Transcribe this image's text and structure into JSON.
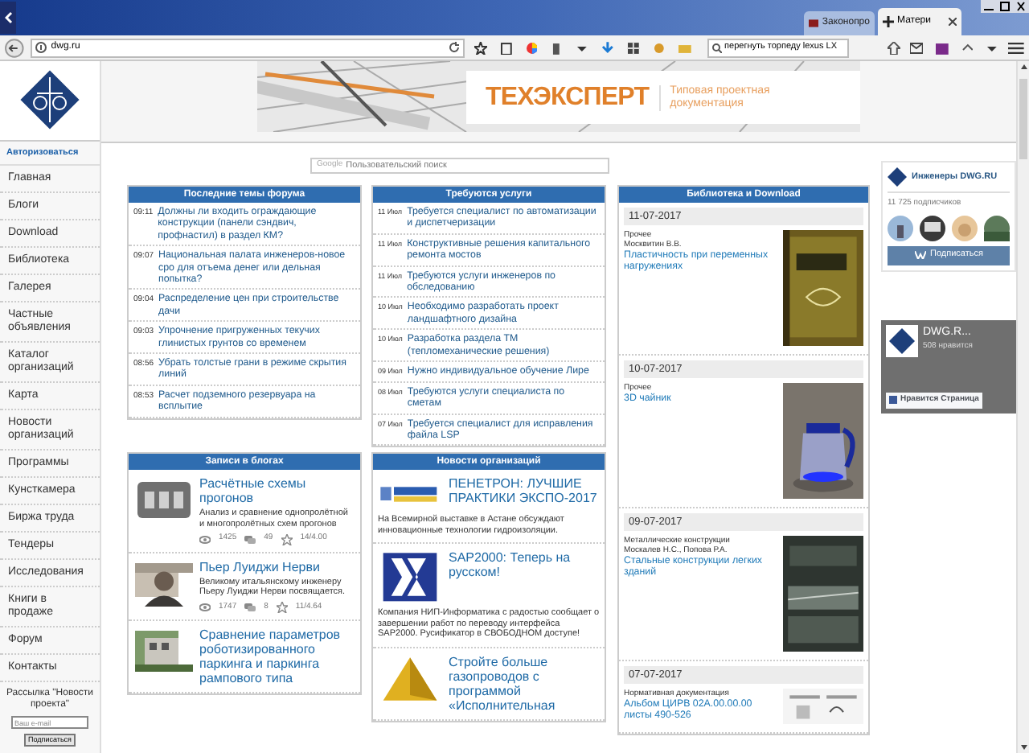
{
  "browser": {
    "tabs": [
      {
        "title": "Законопро",
        "selected": false
      },
      {
        "title": "Матери",
        "selected": true
      }
    ],
    "url": "dwg.ru",
    "search": "перегнуть торпеду lexus LX"
  },
  "banner": {
    "brand": "ТЕХЭКСПЕРТ",
    "tagline": "Типовая проектная документация"
  },
  "sidebar": {
    "login": "Авторизоваться",
    "items": [
      "Главная",
      "Блоги",
      "Download",
      "Библиотека",
      "Галерея",
      "Частные объявления",
      "Каталог организаций",
      "Карта",
      "Новости организаций",
      "Программы",
      "Кунсткамера",
      "Биржа труда",
      "Тендеры",
      "Исследования",
      "Книги в продаже",
      "Форум",
      "Контакты"
    ],
    "newsletter": {
      "title": "Рассылка \"Новости проекта\"",
      "placeholder": "Ваш e-mail",
      "button": "Подписаться"
    }
  },
  "search": {
    "brand": "Google",
    "placeholder": "Пользовательский поиск"
  },
  "forum": {
    "title": "Последние темы форума",
    "topics": [
      {
        "time": "09:11",
        "title": "Должны ли входить ограждающие конструкции (панели сэндвич, профнастил) в раздел КМ?"
      },
      {
        "time": "09:07",
        "title": "Национальная палата инженеров-новое сро для отъема денег или дельная попытка?"
      },
      {
        "time": "09:04",
        "title": "Распределение цен при строительстве дачи"
      },
      {
        "time": "09:03",
        "title": "Упрочнение пригруженных текучих глинистых грунтов со временем"
      },
      {
        "time": "08:56",
        "title": "Убрать толстые грани в режиме скрытия линий"
      },
      {
        "time": "08:53",
        "title": "Расчет подземного резервуара на всплытие"
      }
    ]
  },
  "services": {
    "title": "Требуются услуги",
    "items": [
      {
        "date": "11 Июл",
        "title": "Требуется специалист по автоматизации и диспетчеризации"
      },
      {
        "date": "11 Июл",
        "title": "Конструктивные решения капитального ремонта мостов"
      },
      {
        "date": "11 Июл",
        "title": "Требуются услуги инженеров по обследованию"
      },
      {
        "date": "10 Июл",
        "title": "Необходимо разработать проект ландшафтного дизайна"
      },
      {
        "date": "10 Июл",
        "title": "Разработка раздела ТМ (тепломеханические решения)"
      },
      {
        "date": "09 Июл",
        "title": "Нужно индивидуальное обучение Лире"
      },
      {
        "date": "08 Июл",
        "title": "Требуются услуги специалиста по сметам"
      },
      {
        "date": "07 Июл",
        "title": "Требуется специалист для исправления файла LSP"
      }
    ]
  },
  "blogs": {
    "title": "Записи в блогах",
    "posts": [
      {
        "title": "Расчётные схемы прогонов",
        "excerpt": "Анализ и сравнение однопролётной и многопролётных схем прогонов",
        "views": "1425",
        "comments": "49",
        "rating": "14/4.00"
      },
      {
        "title": "Пьер Луиджи Нерви",
        "excerpt": "Великому итальянскому инженеру Пьеру Луиджи Нерви посвящается.",
        "views": "1747",
        "comments": "8",
        "rating": "11/4.64"
      },
      {
        "title": "Сравнение параметров роботизированного паркинга и паркинга рампового типа"
      }
    ]
  },
  "news": {
    "title": "Новости организаций",
    "items": [
      {
        "title": "ПЕНЕТРОН: ЛУЧШИЕ ПРАКТИКИ ЭКСПО-2017",
        "body": "На Всемирной выставке в Астане обсуждают инновационные технологии гидроизоляции."
      },
      {
        "title": "SAP2000: Теперь на русском!",
        "body": "Компания НИП-Информатика с радостью сообщает о завершении работ по переводу интерфейса SAP2000. Русификатор в СВОБОДНОМ доступе!"
      },
      {
        "title": "Стройте больше газопроводов с программой «Исполнительная"
      }
    ]
  },
  "library": {
    "title": "Библиотека и Download",
    "entries": [
      {
        "date": "11-07-2017",
        "category": "Прочее",
        "author": "Москвитин В.В.",
        "title": "Пластичность при переменных нагружениях"
      },
      {
        "date": "10-07-2017",
        "category": "Прочее",
        "title": "3D чайник"
      },
      {
        "date": "09-07-2017",
        "category": "Металлические конструкции",
        "author": "Москалев Н.С., Попова Р.А.",
        "title": "Стальные конструкции легких зданий"
      },
      {
        "date": "07-07-2017",
        "category": "Нормативная документация",
        "title": "Альбом ЦИРВ 02А.00.00.00 листы 490-526"
      }
    ]
  },
  "vk": {
    "name": "Инженеры DWG.RU",
    "subscribers": "11 725 подписчиков",
    "button": "Подписаться"
  },
  "fb": {
    "name": "DWG.R...",
    "likes": "508 нравится",
    "button": "Нравится Страница"
  }
}
